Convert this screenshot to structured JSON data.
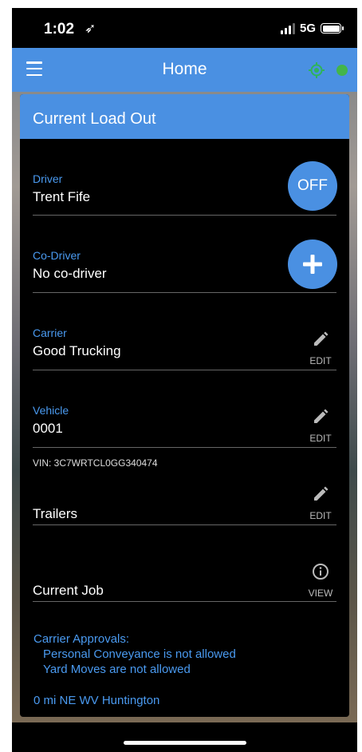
{
  "status_bar": {
    "time": "1:02",
    "location_glyph": "➶",
    "network": "5G"
  },
  "app_bar": {
    "title": "Home",
    "gps_color": "#2fb35a",
    "status_dot_color": "#43b54a",
    "accent": "#4a90e2"
  },
  "card": {
    "title": "Current Load Out",
    "driver": {
      "label": "Driver",
      "value": "Trent Fife",
      "button": "OFF"
    },
    "co_driver": {
      "label": "Co-Driver",
      "value": "No co-driver",
      "button": "+"
    },
    "carrier": {
      "label": "Carrier",
      "value": "Good Trucking",
      "action": "EDIT"
    },
    "vehicle": {
      "label": "Vehicle",
      "value": "0001",
      "action": "EDIT",
      "vin": "VIN: 3C7WRTCL0GG340474"
    },
    "trailers": {
      "value": "Trailers",
      "action": "EDIT"
    },
    "current_job": {
      "value": "Current Job",
      "action": "VIEW"
    },
    "approvals": {
      "title": "Carrier Approvals:",
      "items": [
        "Personal Conveyance is not allowed",
        "Yard Moves are not allowed"
      ]
    },
    "location": "0 mi NE WV Huntington"
  }
}
